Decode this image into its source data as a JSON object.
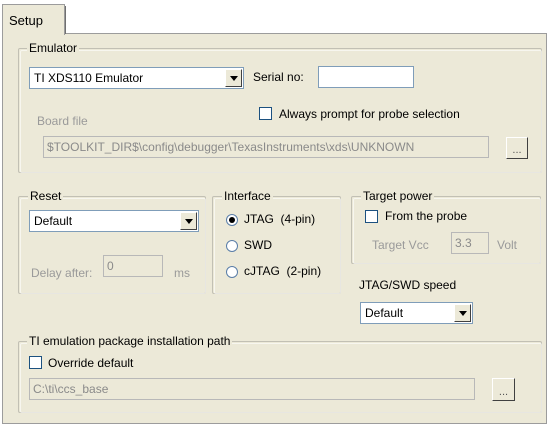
{
  "tabs": {
    "setup": "Setup"
  },
  "emulator": {
    "legend": "Emulator",
    "selected": "TI XDS110 Emulator",
    "serial_label": "Serial no:",
    "serial_value": "",
    "always_prompt_label": "Always prompt for probe selection",
    "board_file_label": "Board file",
    "board_file_value": "$TOOLKIT_DIR$\\config\\debugger\\TexasInstruments\\xds\\UNKNOWN",
    "browse_label": "..."
  },
  "reset": {
    "legend": "Reset",
    "selected": "Default",
    "delay_label": "Delay after:",
    "delay_value": "0",
    "delay_unit": "ms"
  },
  "interface": {
    "legend": "Interface",
    "options": [
      {
        "label": "JTAG  (4-pin)",
        "selected": true
      },
      {
        "label": "SWD",
        "selected": false
      },
      {
        "label": "cJTAG  (2-pin)",
        "selected": false
      }
    ]
  },
  "target_power": {
    "legend": "Target power",
    "from_probe_label": "From the probe",
    "vcc_label": "Target Vcc",
    "vcc_value": "3.3",
    "vcc_unit": "Volt"
  },
  "speed": {
    "label": "JTAG/SWD speed",
    "selected": "Default"
  },
  "ti_path": {
    "legend": "TI emulation package installation path",
    "override_label": "Override default",
    "path_value": "C:\\ti\\ccs_base",
    "browse_label": "..."
  },
  "colors": {
    "panel": "#ece9d8",
    "field_border": "#7f9db9",
    "disabled_text": "#9a9a9a"
  }
}
